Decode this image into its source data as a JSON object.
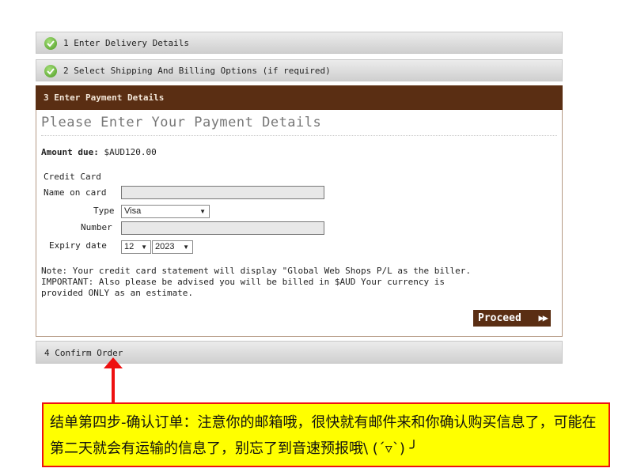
{
  "steps": {
    "step1": "1 Enter Delivery Details",
    "step2": "2 Select Shipping And Billing Options (if required)",
    "step3": "3 Enter Payment Details",
    "step4": "4 Confirm Order"
  },
  "payment": {
    "title": "Please Enter Your Payment Details",
    "amount_label": "Amount due:",
    "amount_value": "$AUD120.00",
    "section_label": "Credit Card",
    "name_label": "Name on card",
    "name_value": "",
    "type_label": "Type",
    "type_value": "Visa",
    "number_label": "Number",
    "number_value": "",
    "expiry_label": "Expiry date",
    "expiry_month": "12",
    "expiry_year": "2023",
    "note": "Note: Your credit card statement will display \"Global Web Shops P/L as the biller.\nIMPORTANT: Also please be advised you will be billed in $AUD Your currency is\nprovided ONLY as an estimate.",
    "proceed_label": "Proceed"
  },
  "annotation": {
    "text": "结单第四步-确认订单：注意你的邮箱哦，很快就有邮件来和你确认购买信息了，可能在第二天就会有运输的信息了，别忘了到音速预报哦\\ (ˊ▿ˋ) ╯"
  },
  "colors": {
    "accent_brown": "#5a2e13",
    "check_green": "#4c9a22",
    "callout_yellow": "#ffff00",
    "callout_red": "#ee1111"
  }
}
